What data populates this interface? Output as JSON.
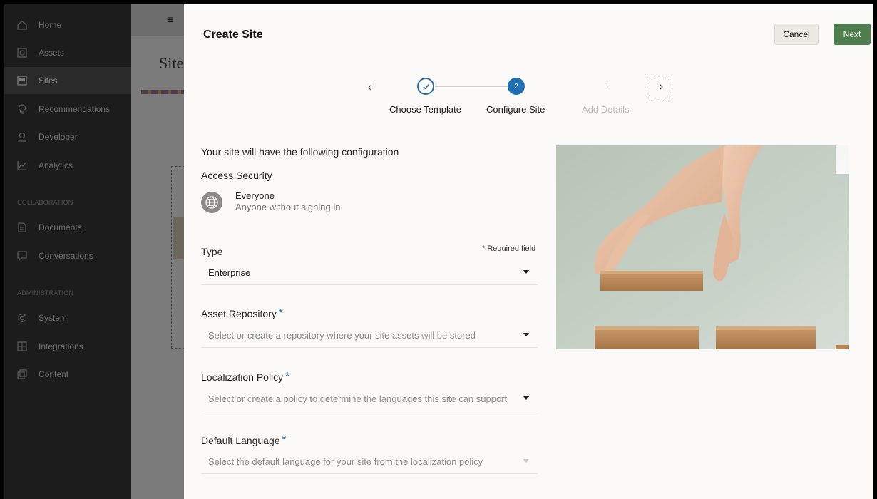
{
  "nav": {
    "items": [
      {
        "label": "Home",
        "icon": "home-icon"
      },
      {
        "label": "Assets",
        "icon": "assets-icon"
      },
      {
        "label": "Sites",
        "icon": "sites-icon"
      },
      {
        "label": "Recommendations",
        "icon": "recommendations-icon"
      },
      {
        "label": "Developer",
        "icon": "developer-icon"
      },
      {
        "label": "Analytics",
        "icon": "analytics-icon"
      }
    ],
    "collaboration_label": "COLLABORATION",
    "collaboration_items": [
      {
        "label": "Documents",
        "icon": "documents-icon"
      },
      {
        "label": "Conversations",
        "icon": "conversations-icon"
      }
    ],
    "administration_label": "ADMINISTRATION",
    "administration_items": [
      {
        "label": "System",
        "icon": "system-gear-icon"
      },
      {
        "label": "Integrations",
        "icon": "integrations-icon"
      },
      {
        "label": "Content",
        "icon": "content-icon"
      }
    ]
  },
  "background_page": {
    "title": "Site"
  },
  "dialog": {
    "title": "Create Site",
    "cancel_label": "Cancel",
    "next_label": "Next",
    "stepper": {
      "steps": [
        {
          "number": "",
          "label": "Choose Template",
          "state": "completed"
        },
        {
          "number": "2",
          "label": "Configure Site",
          "state": "current"
        },
        {
          "number": "3",
          "label": "Add Details",
          "state": "upcoming"
        }
      ]
    },
    "config_intro": "Your site will have the following configuration",
    "access_security_label": "Access Security",
    "access": {
      "title": "Everyone",
      "subtitle": "Anyone without signing in"
    },
    "required_note": "* Required field",
    "type": {
      "label": "Type",
      "value": "Enterprise"
    },
    "asset_repository": {
      "label": "Asset Repository",
      "required": "*",
      "placeholder": "Select or create a repository where your site assets will be stored"
    },
    "localization_policy": {
      "label": "Localization Policy",
      "required": "*",
      "placeholder": "Select or create a policy to determine the languages this site can support"
    },
    "default_language": {
      "label": "Default Language",
      "required": "*",
      "placeholder": "Select the default language for your site from the localization policy"
    }
  },
  "colors": {
    "nav_bg": "#1c1c1c",
    "dialog_bg": "#fbfaf8",
    "accent_blue": "#1e6fb4",
    "next_button": "#4e7d4e"
  }
}
